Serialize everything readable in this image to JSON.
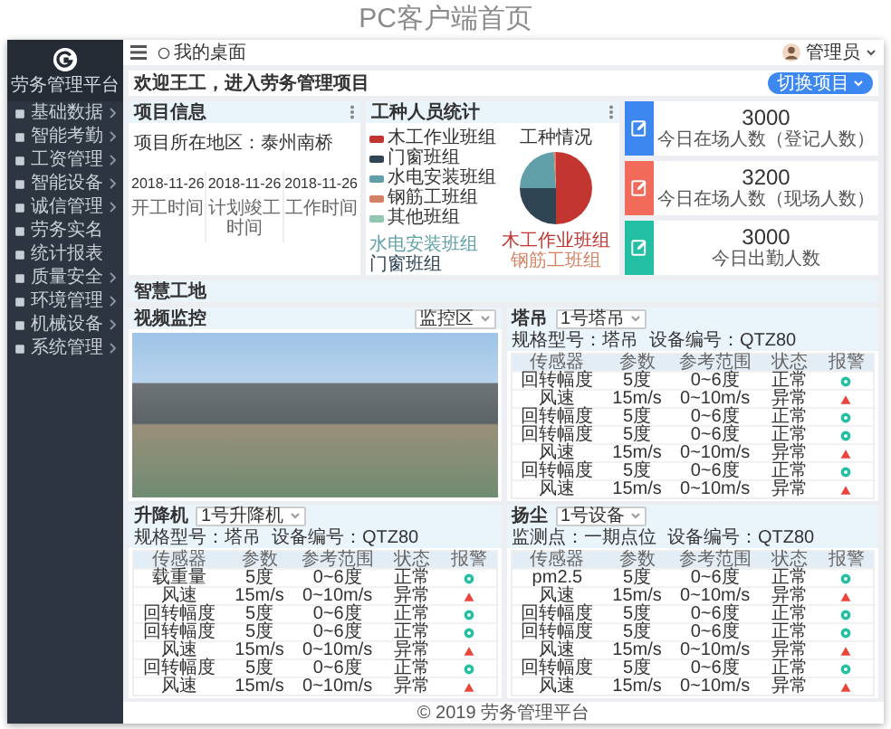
{
  "page_title": "PC客户端首页",
  "sidebar": {
    "title": "劳务管理平台",
    "items": [
      {
        "label": "基础数据",
        "expandable": true
      },
      {
        "label": "智能考勤",
        "expandable": true
      },
      {
        "label": "工资管理",
        "expandable": true
      },
      {
        "label": "智能设备",
        "expandable": true
      },
      {
        "label": "诚信管理",
        "expandable": true
      },
      {
        "label": "劳务实名",
        "expandable": false
      },
      {
        "label": "统计报表",
        "expandable": false
      },
      {
        "label": "质量安全",
        "expandable": true
      },
      {
        "label": "环境管理",
        "expandable": true
      },
      {
        "label": "机械设备",
        "expandable": true
      },
      {
        "label": "系统管理",
        "expandable": true
      }
    ]
  },
  "topbar": {
    "user": "管理员"
  },
  "breadcrumb": "我的桌面",
  "welcome": {
    "text": "欢迎王工，进入劳务管理项目",
    "button": "切换项目"
  },
  "project_info": {
    "title": "项目信息",
    "location": "项目所在地区：泰州南桥",
    "dates": [
      {
        "value": "2018-11-26",
        "label": "开工时间"
      },
      {
        "value": "2018-11-26",
        "label": "计划竣工时间"
      },
      {
        "value": "2018-11-26",
        "label": "工作时间"
      }
    ]
  },
  "worker_stats": {
    "title": "工种人员统计",
    "chart_title": "工种情况",
    "legend": [
      {
        "label": "木工作业班组",
        "color": "#c23531"
      },
      {
        "label": "门窗班组",
        "color": "#2f4554"
      },
      {
        "label": "水电安装班组",
        "color": "#61a0a8"
      },
      {
        "label": "钢筋工班组",
        "color": "#d48265"
      },
      {
        "label": "其他班组",
        "color": "#91c7ae"
      }
    ],
    "pie_labels": [
      {
        "text": "水电安装班组",
        "color": "#61a0a8"
      },
      {
        "text": "门窗班组",
        "color": "#2f4554"
      },
      {
        "text": "木工作业班组",
        "color": "#c23531"
      },
      {
        "text": "钢筋工班组",
        "color": "#d48265"
      }
    ]
  },
  "stat_cards": [
    {
      "value": "3000",
      "label": "今日在场人数（登记人数）",
      "color": "#3d88f0"
    },
    {
      "value": "3200",
      "label": "今日在场人数（现场人数）",
      "color": "#f26b5a"
    },
    {
      "value": "3000",
      "label": "今日出勤人数",
      "color": "#22bfa3"
    }
  ],
  "section_title": "智慧工地",
  "video": {
    "title": "视频监控",
    "dropdown": "监控区"
  },
  "monitors": [
    {
      "title": "塔吊",
      "dropdown": "1号塔吊",
      "info": [
        "规格型号：塔吊",
        "设备编号：QTZ80"
      ],
      "columns": [
        "传感器",
        "参数",
        "参考范围",
        "状态",
        "报警"
      ],
      "rows": [
        {
          "cells": [
            "回转幅度",
            "5度",
            "0~6度",
            "正常"
          ],
          "alarm": false
        },
        {
          "cells": [
            "风速",
            "15m/s",
            "0~10m/s",
            "异常"
          ],
          "alarm": true
        },
        {
          "cells": [
            "回转幅度",
            "5度",
            "0~6度",
            "正常"
          ],
          "alarm": false
        },
        {
          "cells": [
            "回转幅度",
            "5度",
            "0~6度",
            "正常"
          ],
          "alarm": false
        },
        {
          "cells": [
            "风速",
            "15m/s",
            "0~10m/s",
            "异常"
          ],
          "alarm": true
        },
        {
          "cells": [
            "回转幅度",
            "5度",
            "0~6度",
            "正常"
          ],
          "alarm": false
        },
        {
          "cells": [
            "风速",
            "15m/s",
            "0~10m/s",
            "异常"
          ],
          "alarm": true
        }
      ]
    },
    {
      "title": "升降机",
      "dropdown": "1号升降机",
      "info": [
        "规格型号：塔吊",
        "设备编号：QTZ80"
      ],
      "columns": [
        "传感器",
        "参数",
        "参考范围",
        "状态",
        "报警"
      ],
      "rows": [
        {
          "cells": [
            "载重量",
            "5度",
            "0~6度",
            "正常"
          ],
          "alarm": false
        },
        {
          "cells": [
            "风速",
            "15m/s",
            "0~10m/s",
            "异常"
          ],
          "alarm": true
        },
        {
          "cells": [
            "回转幅度",
            "5度",
            "0~6度",
            "正常"
          ],
          "alarm": false
        },
        {
          "cells": [
            "回转幅度",
            "5度",
            "0~6度",
            "正常"
          ],
          "alarm": false
        },
        {
          "cells": [
            "风速",
            "15m/s",
            "0~10m/s",
            "异常"
          ],
          "alarm": true
        },
        {
          "cells": [
            "回转幅度",
            "5度",
            "0~6度",
            "正常"
          ],
          "alarm": false
        },
        {
          "cells": [
            "风速",
            "15m/s",
            "0~10m/s",
            "异常"
          ],
          "alarm": true
        }
      ]
    },
    {
      "title": "扬尘",
      "dropdown": "1号设备",
      "info": [
        "监测点：一期点位",
        "设备编号：QTZ80"
      ],
      "columns": [
        "传感器",
        "参数",
        "参考范围",
        "状态",
        "报警"
      ],
      "rows": [
        {
          "cells": [
            "pm2.5",
            "5度",
            "0~6度",
            "正常"
          ],
          "alarm": false
        },
        {
          "cells": [
            "风速",
            "15m/s",
            "0~10m/s",
            "异常"
          ],
          "alarm": true
        },
        {
          "cells": [
            "回转幅度",
            "5度",
            "0~6度",
            "正常"
          ],
          "alarm": false
        },
        {
          "cells": [
            "回转幅度",
            "5度",
            "0~6度",
            "正常"
          ],
          "alarm": false
        },
        {
          "cells": [
            "风速",
            "15m/s",
            "0~10m/s",
            "异常"
          ],
          "alarm": true
        },
        {
          "cells": [
            "回转幅度",
            "5度",
            "0~6度",
            "正常"
          ],
          "alarm": false
        },
        {
          "cells": [
            "风速",
            "15m/s",
            "0~10m/s",
            "异常"
          ],
          "alarm": true
        }
      ]
    }
  ],
  "footer": "© 2019 劳务管理平台"
}
